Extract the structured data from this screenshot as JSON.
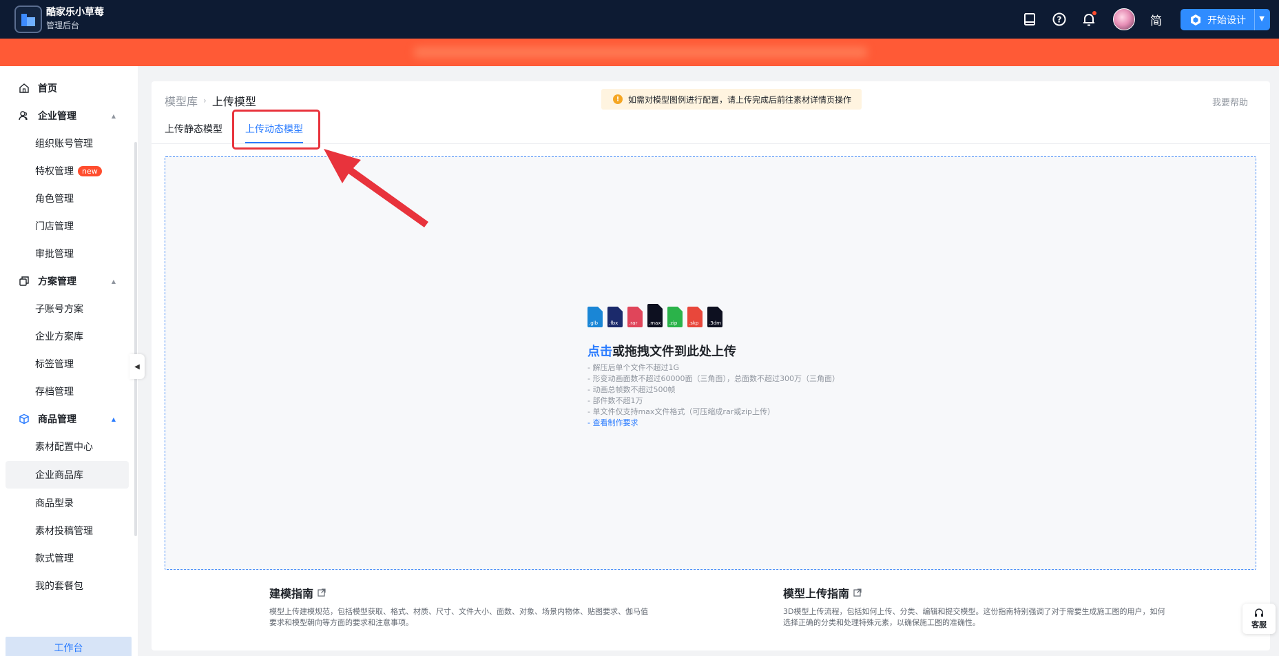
{
  "header": {
    "brand_title": "酷家乐小草莓",
    "brand_subtitle": "管理后台",
    "lang_label": "简",
    "design_button_label": "开始设计",
    "icons": [
      "book-icon",
      "help-icon",
      "bell-icon"
    ]
  },
  "sidebar": {
    "groups": [
      {
        "label": "首页",
        "icon": "home-icon"
      },
      {
        "label": "企业管理",
        "icon": "team-icon",
        "items": [
          "组织账号管理",
          "特权管理",
          "角色管理",
          "门店管理",
          "审批管理"
        ]
      },
      {
        "label": "方案管理",
        "icon": "copy-icon",
        "items": [
          "子账号方案",
          "企业方案库",
          "标签管理",
          "存档管理"
        ]
      },
      {
        "label": "商品管理",
        "icon": "cube-icon",
        "items": [
          "素材配置中心",
          "企业商品库",
          "商品型录",
          "素材投稿管理",
          "款式管理",
          "我的套餐包"
        ]
      }
    ],
    "new_badge": "new",
    "workbench_label": "工作台"
  },
  "main": {
    "breadcrumb": {
      "parent": "模型库",
      "separator": "›",
      "current": "上传模型"
    },
    "notice": "如需对模型图例进行配置，请上传完成后前往素材详情页操作",
    "help_link": "我要帮助",
    "tabs": [
      {
        "label": "上传静态模型",
        "active": false
      },
      {
        "label": "上传动态模型",
        "active": true
      }
    ],
    "upload": {
      "file_types": [
        {
          "ext": ".glb",
          "color": "#1a86d6"
        },
        {
          "ext": ".fbx",
          "color": "#1b2a6b"
        },
        {
          "ext": ".rar",
          "color": "#e0455a"
        },
        {
          "ext": ".max",
          "color": "#0d1020"
        },
        {
          "ext": ".zip",
          "color": "#2bb34a"
        },
        {
          "ext": ".skp",
          "color": "#e8473b"
        },
        {
          "ext": ".3dm",
          "color": "#0d1020"
        }
      ],
      "title_click": "点击",
      "title_rest": "或拖拽文件到此处上传",
      "rules": [
        "- 解压后单个文件不超过1G",
        "- 形变动画面数不超过60000面（三角面），总面数不超过300万（三角面）",
        "- 动画总帧数不超过500帧",
        "- 部件数不超1万",
        "- 单文件仅支持max文件格式（可压缩成rar或zip上传）"
      ],
      "requirements_link": "- 查看制作要求"
    },
    "guides": [
      {
        "title": "建模指南",
        "desc": "模型上传建模规范，包括模型获取、格式、材质、尺寸、文件大小、面数、对象、场景内物体、贴图要求、伽马值要求和模型朝向等方面的要求和注意事项。"
      },
      {
        "title": "模型上传指南",
        "desc": "3D模型上传流程，包括如何上传、分类、编辑和提交模型。这份指南特别强调了对于需要生成施工图的用户，如何选择正确的分类和处理特殊元素，以确保施工图的准确性。"
      }
    ]
  },
  "customer_service_label": "客服",
  "colors": {
    "accent": "#2b7cff",
    "banner": "#ff5a36",
    "header": "#0d1b33",
    "highlight": "#e8333c"
  }
}
